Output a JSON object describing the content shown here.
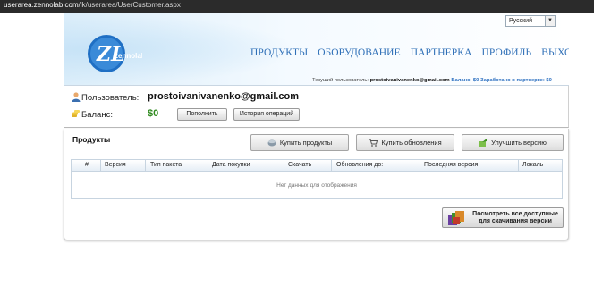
{
  "browser": {
    "url_host": "userarea.zennolab.com",
    "url_path": "/lk/userarea/UserCustomer.aspx"
  },
  "header": {
    "logo_text": "zennolab.com",
    "logo_letters": "ZL",
    "language": "Русский",
    "nav": [
      "ПРОДУКТЫ",
      "ОБОРУДОВАНИЕ",
      "ПАРТНЕРКА",
      "ПРОФИЛЬ",
      "ВЫХОД"
    ],
    "current_user_label": "Текущий пользователь:",
    "current_user_email": "prostoivanivanenko@gmail.com",
    "balance_text": "Баланс: $0",
    "partner_text": "Заработано в партнерке: $0"
  },
  "user_panel": {
    "user_label": "Пользователь:",
    "email": "prostoivanivanenko@gmail.com",
    "balance_label": "Баланс:",
    "balance_value": "$0",
    "topup_button": "Пополнить",
    "history_button": "История операций"
  },
  "products": {
    "title": "Продукты",
    "buy_button": "Купить продукты",
    "buy_updates_button": "Купить обновления",
    "upgrade_button": "Улучшить версию",
    "columns": [
      "#",
      "Версия",
      "Тип пакета",
      "Дата покупки",
      "Скачать",
      "Обновления до:",
      "Последняя версия",
      "Локаль"
    ],
    "empty_text": "Нет данных для отображения",
    "download_all_line1": "Посмотреть все доступные",
    "download_all_line2": "для скачивания версии"
  },
  "colors": {
    "nav_link": "#2e6fb7",
    "balance_green": "#2f8a1f",
    "header_bg": "#dceefa"
  }
}
